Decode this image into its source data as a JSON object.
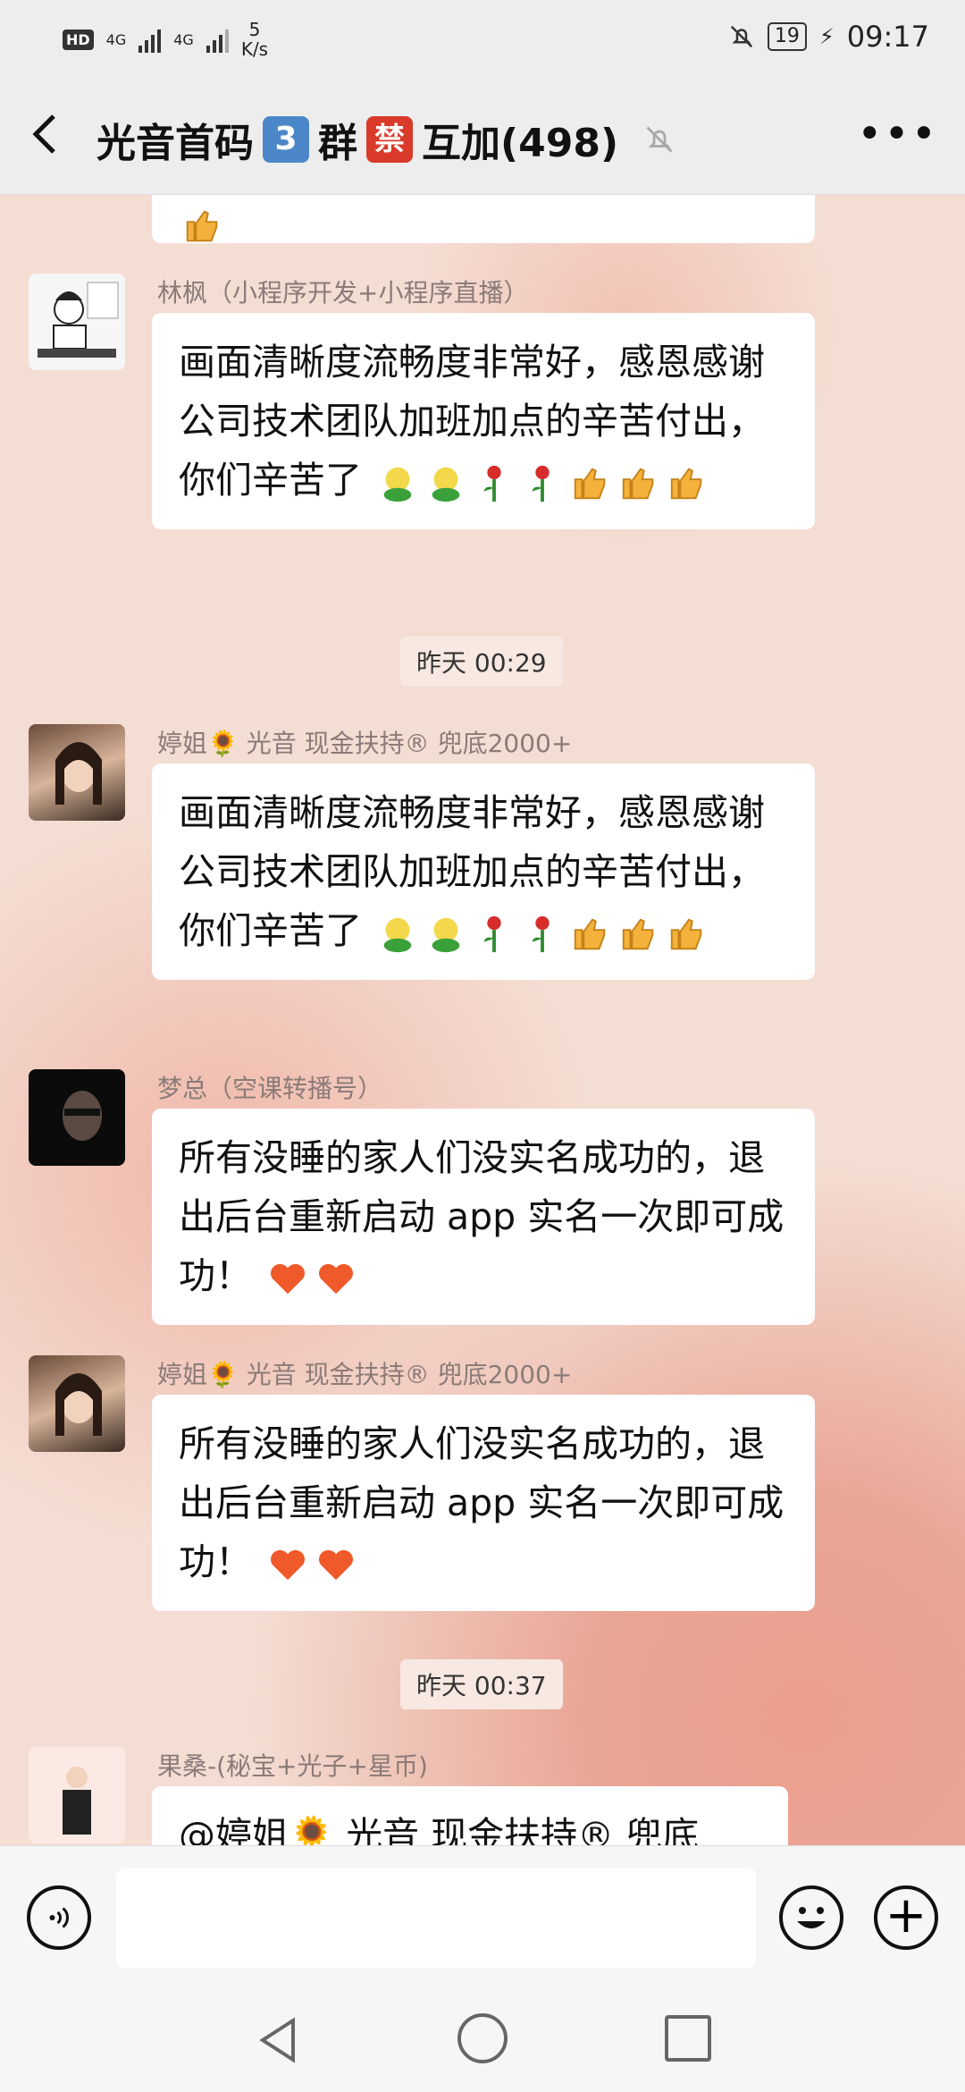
{
  "status_bar": {
    "hd": "HD",
    "sim1": "4G",
    "sim2": "4G",
    "speed_value": "5",
    "speed_unit": "K/s",
    "battery": "19",
    "time": "09:17"
  },
  "title_bar": {
    "title_part1": "光音首码",
    "badge_number": "3",
    "title_part2": "群",
    "badge_char": "禁",
    "title_part3": "互加(498)"
  },
  "messages": [
    {
      "sender": "林枫（小程序开发+小程序直播）",
      "text": "画面清晰度流畅度非常好，感恩感谢公司技术团队加班加点的辛苦付出，你们辛苦了"
    },
    {
      "time": "昨天 00:29"
    },
    {
      "sender": "婷姐🌻 光音 现金扶持® 兜底2000+",
      "text": "画面清晰度流畅度非常好，感恩感谢公司技术团队加班加点的辛苦付出，你们辛苦了"
    },
    {
      "sender": "梦总（空课转播号）",
      "text": "所有没睡的家人们没实名成功的，退出后台重新启动 app 实名一次即可成功！"
    },
    {
      "sender": "婷姐🌻 光音 现金扶持® 兜底2000+",
      "text": "所有没睡的家人们没实名成功的，退出后台重新启动 app 实名一次即可成功！"
    },
    {
      "time": "昨天 00:37"
    },
    {
      "sender": "果桑-(秘宝+光子+星币)",
      "text": "@婷姐🌻 光音 现金扶持® 兜底"
    }
  ],
  "input_bar": {
    "placeholder": ""
  },
  "icons": {
    "back": "chevron-left-icon",
    "mute": "bell-off-icon",
    "more": "more-dots-icon",
    "voice": "voice-icon",
    "emoji": "smiley-icon",
    "plus": "plus-icon"
  }
}
